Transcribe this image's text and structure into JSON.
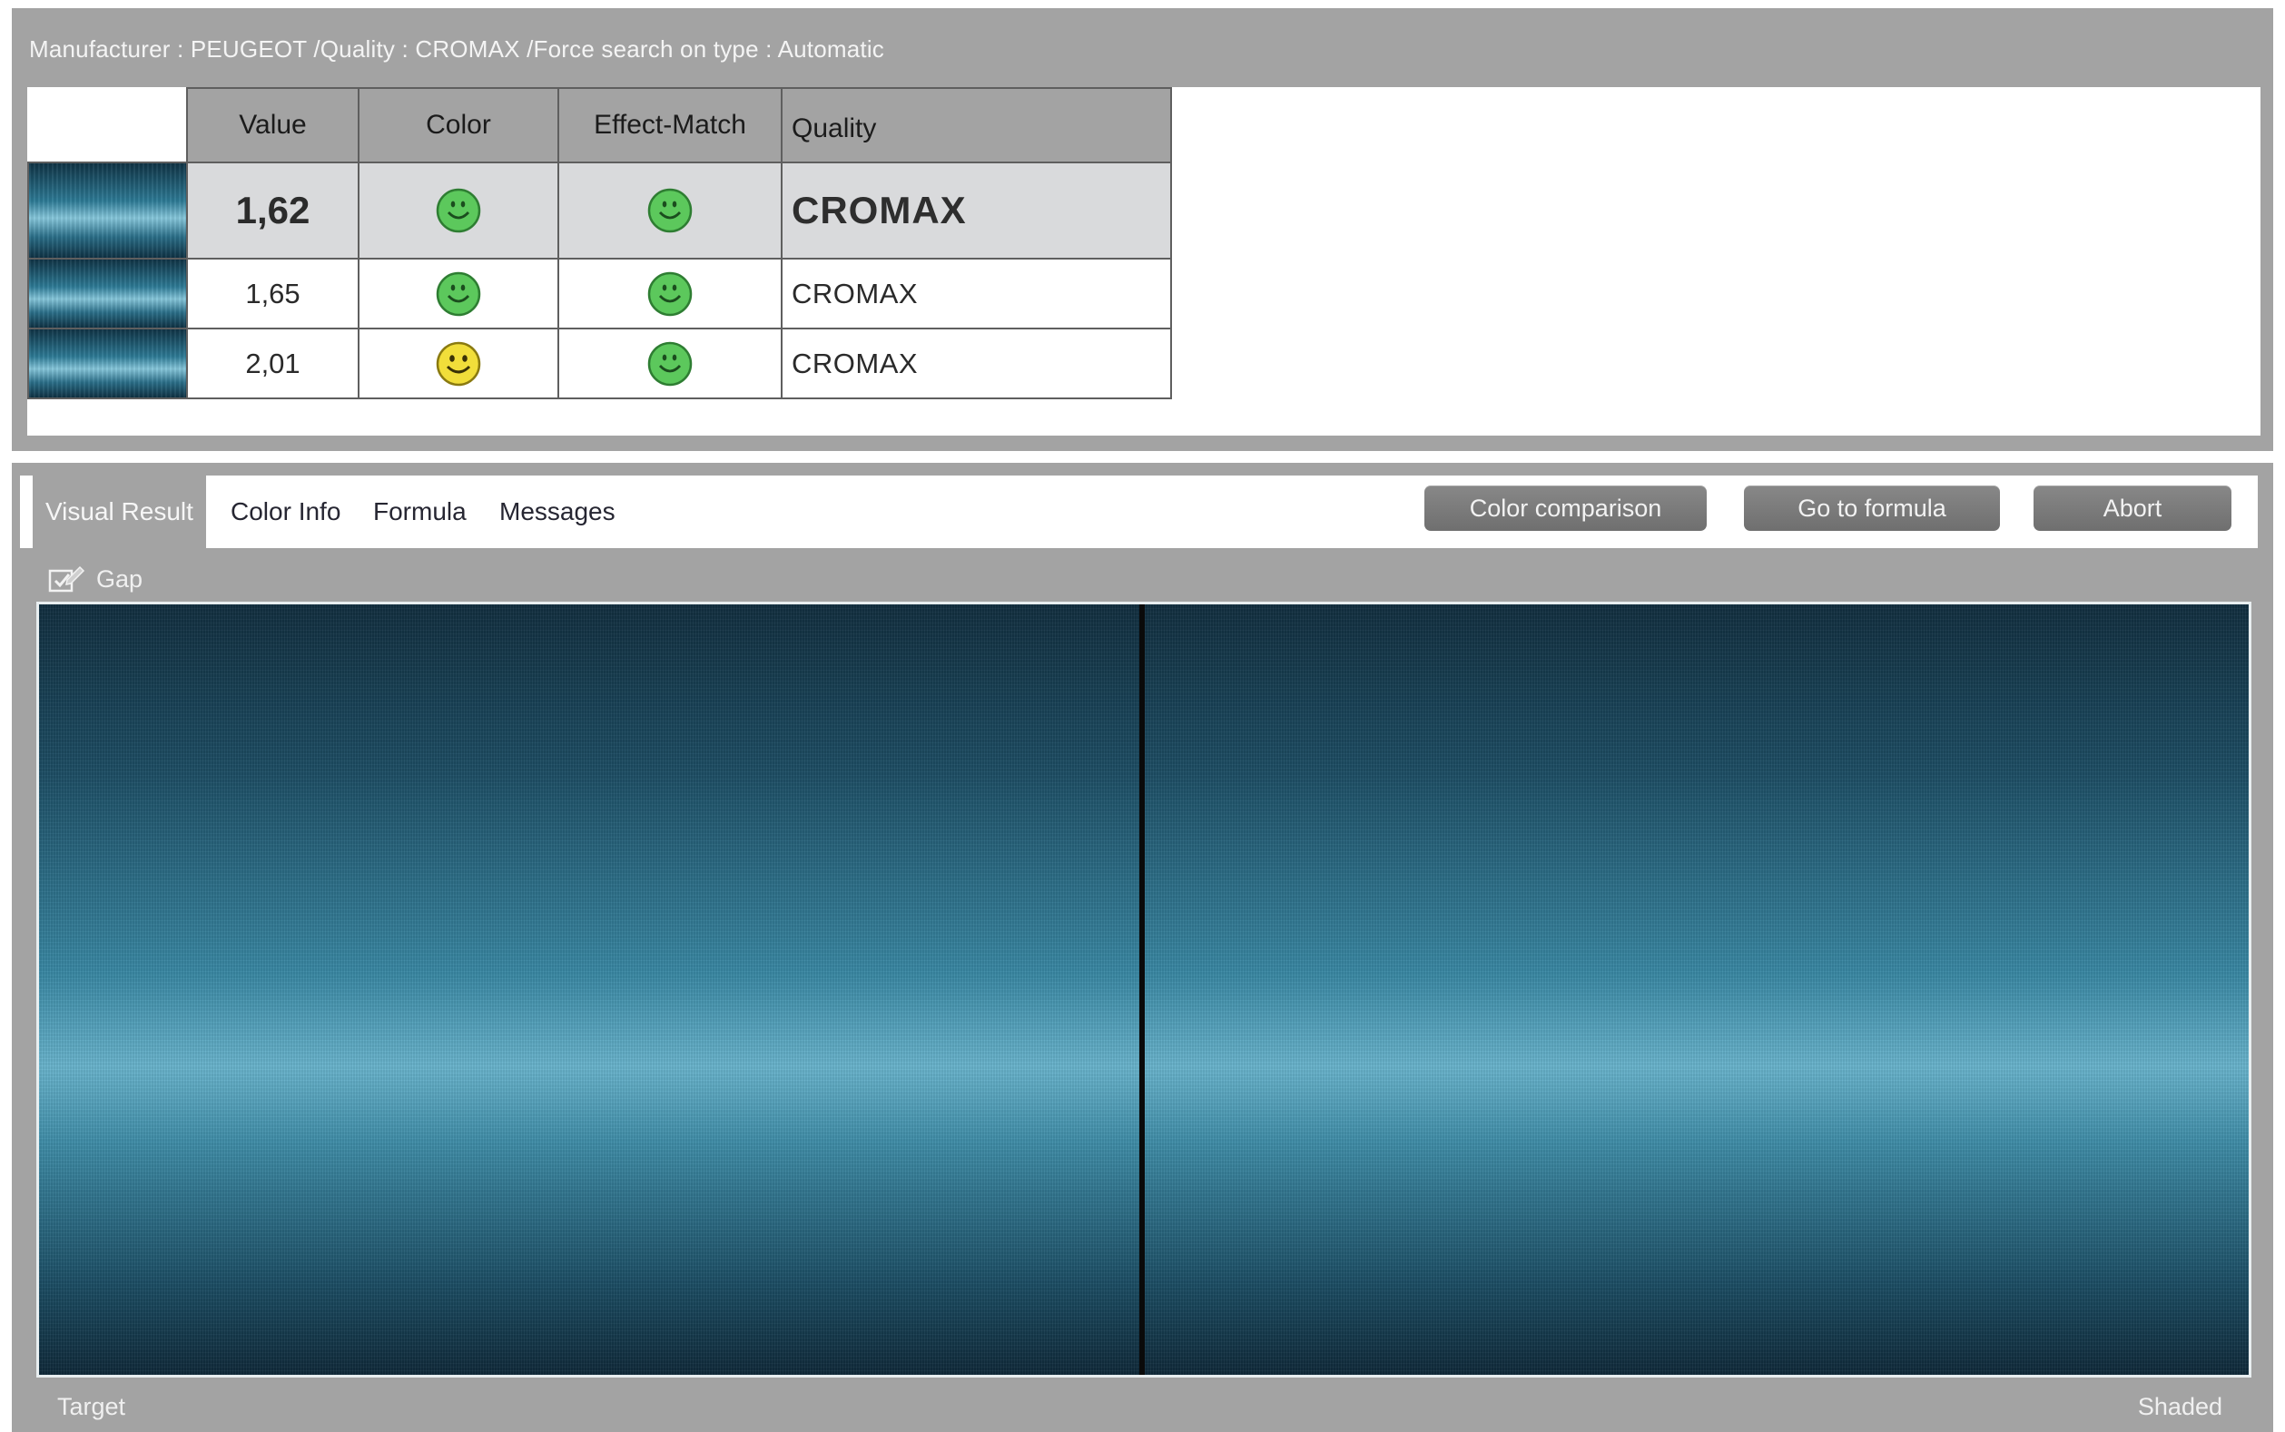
{
  "header": {
    "search_info": "Manufacturer : PEUGEOT /Quality : CROMAX /Force search on type : Automatic"
  },
  "results_table": {
    "columns": [
      "Value",
      "Color",
      "Effect-Match",
      "Quality"
    ],
    "rows": [
      {
        "value": "1,62",
        "color_status": "green-smiley-icon",
        "effect_status": "green-smiley-icon",
        "quality": "CROMAX",
        "selected": true
      },
      {
        "value": "1,65",
        "color_status": "green-smiley-icon",
        "effect_status": "green-smiley-icon",
        "quality": "CROMAX",
        "selected": false
      },
      {
        "value": "2,01",
        "color_status": "yellow-smiley-icon",
        "effect_status": "green-smiley-icon",
        "quality": "CROMAX",
        "selected": false
      }
    ]
  },
  "tabs": [
    {
      "label": "Visual Result",
      "active": true
    },
    {
      "label": "Color Info",
      "active": false
    },
    {
      "label": "Formula",
      "active": false
    },
    {
      "label": "Messages",
      "active": false
    }
  ],
  "buttons": {
    "color_comparison": "Color comparison",
    "go_to_formula": "Go to formula",
    "abort": "Abort"
  },
  "gap": {
    "label": "Gap",
    "checked": true,
    "icon": "checkbox-edit-icon"
  },
  "viewer": {
    "left_label": "Target",
    "right_label": "Shaded"
  },
  "colors": {
    "panel_gray": "#a3a3a3",
    "selected_row": "#d9dadc",
    "smiley_green": "#5cc85c",
    "smiley_yellow": "#f1de3a",
    "paint_dark": "#122f40",
    "paint_light": "#6ab6cf"
  }
}
